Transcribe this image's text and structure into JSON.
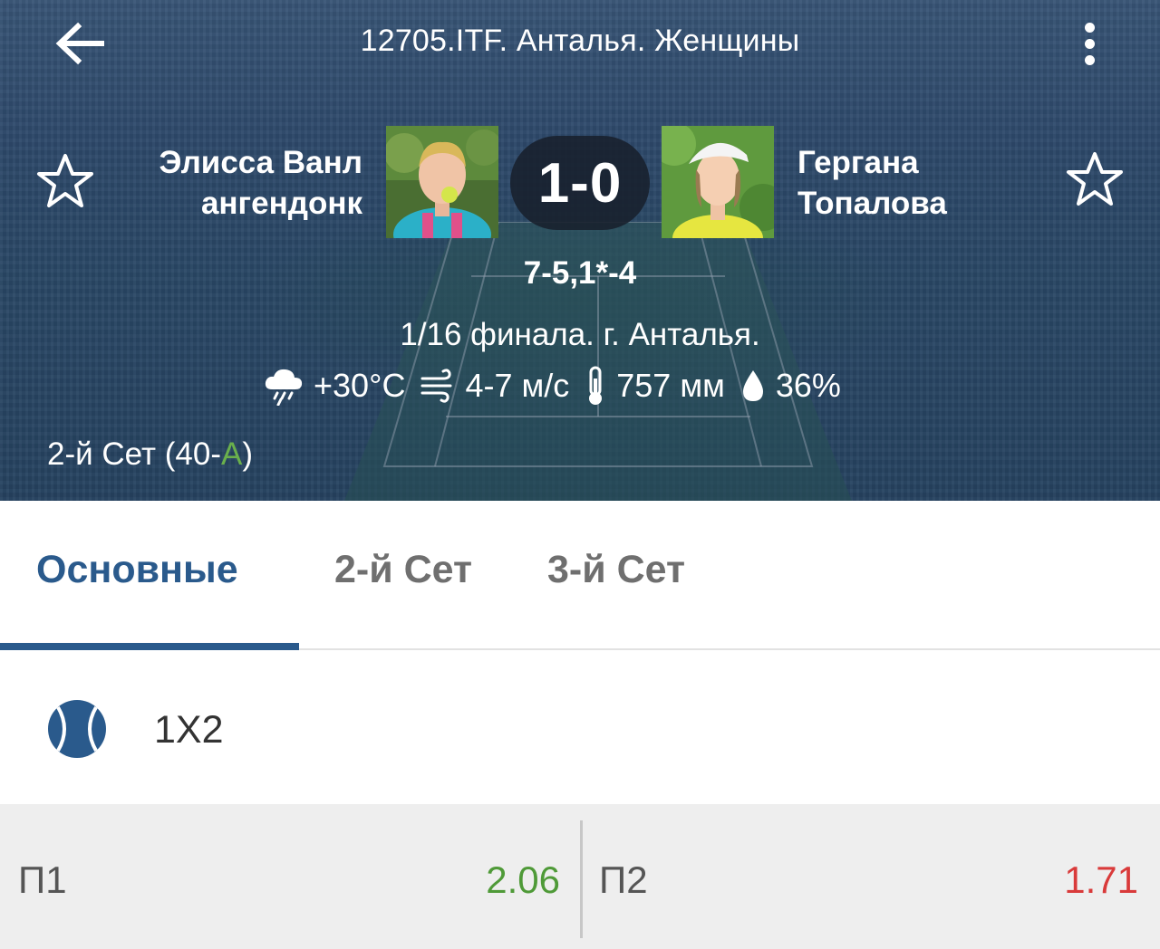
{
  "header": {
    "title": "12705.ITF. Анталья. Женщины",
    "back_icon": "arrow-left-icon",
    "menu_icon": "more-vertical-icon"
  },
  "match": {
    "player1": {
      "name_line1": "Элисса Ванл",
      "name_line2": "ангендонк",
      "favorite_icon": "star-outline-icon"
    },
    "player2": {
      "name_line1": "Гергана",
      "name_line2": "Топалова",
      "favorite_icon": "star-outline-icon"
    },
    "score": "1-0",
    "set_scores": "7-5,1*-4",
    "round_info": "1/16 финала. г. Анталья.",
    "weather": {
      "temperature": "+30°C",
      "wind": "4-7 м/с",
      "pressure": "757 мм",
      "humidity": "36%"
    },
    "current_set_prefix": "2-й Сет (40-",
    "current_set_adv": "А",
    "current_set_suffix": ")"
  },
  "tabs": [
    {
      "label": "Основные",
      "active": true
    },
    {
      "label": "2-й Сет",
      "active": false
    },
    {
      "label": "3-й Сет",
      "active": false
    }
  ],
  "market": {
    "icon": "tennis-ball-icon",
    "title": "1X2",
    "odds": [
      {
        "label": "П1",
        "value": "2.06",
        "color": "#4f9a38"
      },
      {
        "label": "П2",
        "value": "1.71",
        "color": "#d93a3a"
      }
    ]
  },
  "colors": {
    "accent": "#2a5a8c",
    "header_overlay": "#2e4a66",
    "odd_up": "#4f9a38",
    "odd_down": "#d93a3a",
    "advantage": "#6ab04c"
  }
}
